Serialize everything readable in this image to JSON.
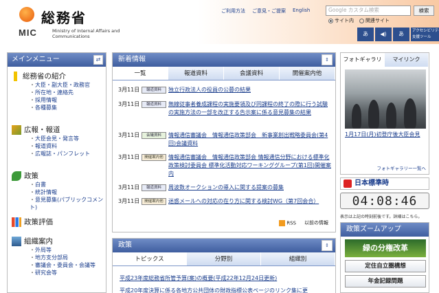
{
  "header": {
    "logo_jp": "総務省",
    "logo_mic": "MIC",
    "logo_en": "Ministry of Internal Affairs and Communications",
    "nav": [
      "ご利用方法",
      "ご意見・ご提案",
      "English"
    ],
    "search": {
      "placeholder": "Google カスタム検索",
      "button": "検索"
    },
    "scope": [
      "サイト内",
      "関連サイト"
    ],
    "a11y": [
      "ruby-icon",
      "voice-icon",
      "text-size-icon"
    ],
    "a11y_tool_label": "アクセシビリティ 閲覧支援ツール"
  },
  "leftnav": {
    "title": "メインメニュー",
    "sections": [
      {
        "title": "総務省の紹介",
        "icon": "exclamation-icon",
        "items": [
          "大臣・副大臣・政務官",
          "所在地・連絡先",
          "採用情報",
          "各種募集"
        ]
      },
      {
        "title": "広報・報道",
        "icon": "megaphone-icon",
        "items": [
          "大臣会見・発言等",
          "報道資料",
          "広報誌・パンフレット"
        ]
      },
      {
        "title": "政策",
        "icon": "leaf-icon",
        "items": [
          "白書",
          "統計情報",
          "意見募集(パブリックコメント)"
        ]
      },
      {
        "title": "政策評価",
        "icon": "bar-chart-icon",
        "items": []
      },
      {
        "title": "組織案内",
        "icon": "building-icon",
        "items": [
          "外局等",
          "地方支分部局",
          "審議会・委員会・会議等",
          "研究会等"
        ]
      }
    ]
  },
  "news": {
    "title": "新着情報",
    "tabs": [
      "一覧",
      "報道資料",
      "会議資料",
      "開催案内他"
    ],
    "items": [
      {
        "date": "3月11日",
        "badge": "報道資料",
        "kind": "b1",
        "text": "独立行政法人の役員の公募の結果"
      },
      {
        "date": "3月11日",
        "badge": "報道資料",
        "kind": "b1",
        "text": "無線従事者養成課程の実施要領及び同課程の終了の際に行う試験の実施方法の一部を改正する告示案に係る意見募集の結果"
      },
      {
        "date": "3月11日",
        "badge": "会議資料",
        "kind": "b2",
        "text": "情報通信審議会　情報通信政策部会　新事業創出戦略委員会(第4回)会議資料"
      },
      {
        "date": "3月11日",
        "badge": "開催案内他",
        "kind": "b3",
        "text": "情報通信審議会　情報通信政策部会 情報通信分野における標準化政策検討委員会 標準化活動対応ワーキンググループ(第1回)開催案内"
      },
      {
        "date": "3月11日",
        "badge": "報道資料",
        "kind": "b1",
        "text": "周波数オークションの導入に関する提案の募集"
      },
      {
        "date": "3月11日",
        "badge": "開催案内他",
        "kind": "b3",
        "text": "迷惑メールへの対応の在り方に関する検討WG（第7回会合）"
      }
    ],
    "rss": "RSS",
    "more": "以前の情報"
  },
  "policy": {
    "title": "政策",
    "tabs": [
      "トピックス",
      "分野別",
      "組織別"
    ],
    "items": [
      "平成23年度総務省所管予算(案)の概要(平成22年12月24日更新)",
      "平成20年度決算に係る各地方公共団体の財政指標公表ページのリンク集に更"
    ]
  },
  "photo": {
    "tabs": [
      "フォトギャラリー",
      "マイリンク"
    ],
    "caption": "1月17日(月)初登庁後大臣会見",
    "more": "フォトギャラリー一覧へ"
  },
  "clock": {
    "title": "日本標準時",
    "time": "04:08:46",
    "note": "表示は上記の時刻前後です。詳細はこちら。"
  },
  "zoom": {
    "title": "政策ズームアップ",
    "banner": "緑の分権改革",
    "buttons": [
      "定住自立圏構想",
      "年金記録問題"
    ]
  }
}
